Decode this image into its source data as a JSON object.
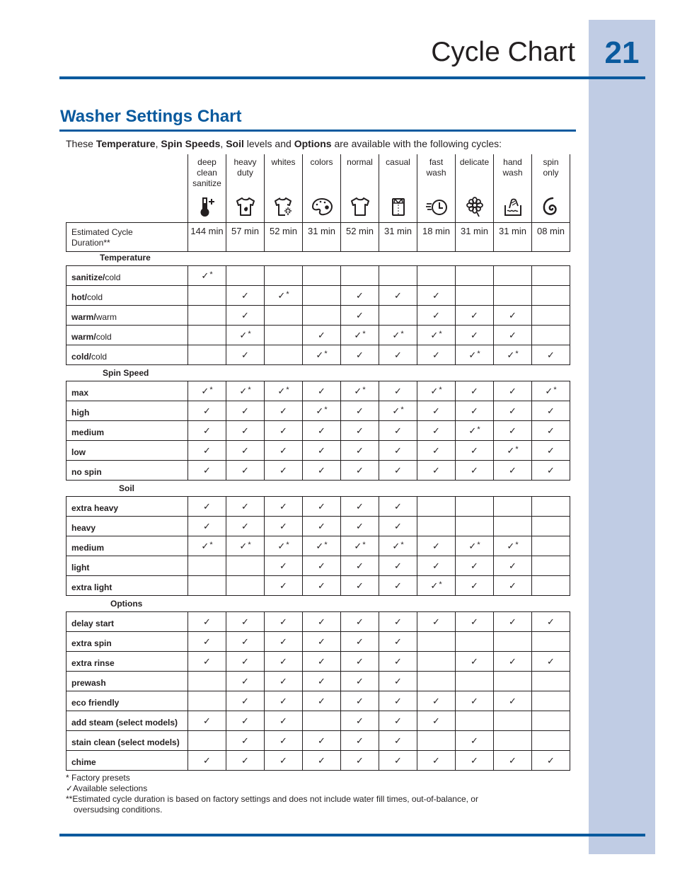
{
  "page": {
    "title": "Cycle Chart",
    "number": "21"
  },
  "section": {
    "title": "Washer Settings Chart",
    "intro": {
      "t1": "These ",
      "b1": "Temperature",
      "t2": ", ",
      "b2": "Spin Speeds",
      "t3": ", ",
      "b3": "Soil",
      "t4": " levels and ",
      "b4": "Options",
      "t5": " are available with the following cycles:"
    }
  },
  "colors": {
    "accent_blue": "#0a5a9e",
    "side_band": "#c0cce4",
    "text": "#231f20"
  },
  "cycles": [
    {
      "label": "deep clean sanitize",
      "lines": [
        "deep",
        "clean",
        "sanitize"
      ],
      "icon": "thermometer-plus-icon",
      "duration": "144 min"
    },
    {
      "label": "heavy duty",
      "lines": [
        "heavy",
        "duty"
      ],
      "icon": "shirt-stain-icon",
      "duration": "57 min"
    },
    {
      "label": "whites",
      "lines": [
        "whites"
      ],
      "icon": "shirt-sparkle-icon",
      "duration": "52 min"
    },
    {
      "label": "colors",
      "lines": [
        "colors"
      ],
      "icon": "palette-icon",
      "duration": "31 min"
    },
    {
      "label": "normal",
      "lines": [
        "normal"
      ],
      "icon": "shirt-icon",
      "duration": "52 min"
    },
    {
      "label": "casual",
      "lines": [
        "casual"
      ],
      "icon": "collared-shirt-icon",
      "duration": "31 min"
    },
    {
      "label": "fast wash",
      "lines": [
        "fast",
        "wash"
      ],
      "icon": "fast-clock-icon",
      "duration": "18 min"
    },
    {
      "label": "delicate",
      "lines": [
        "delicate"
      ],
      "icon": "flower-icon",
      "duration": "31 min"
    },
    {
      "label": "hand wash",
      "lines": [
        "hand",
        "wash"
      ],
      "icon": "hand-basin-icon",
      "duration": "31 min"
    },
    {
      "label": "spin only",
      "lines": [
        "spin",
        "only"
      ],
      "icon": "spiral-icon",
      "duration": "08 min"
    }
  ],
  "duration_label": {
    "line1": "Estimated Cycle",
    "line2": "Duration**"
  },
  "legend": {
    "check": "✓",
    "preset_mark": "*"
  },
  "groups": [
    {
      "title": "Temperature",
      "rows": [
        {
          "bold": "sanitize/",
          "normal": "cold",
          "cells": [
            "P",
            "",
            "",
            "",
            "",
            "",
            "",
            "",
            "",
            ""
          ]
        },
        {
          "bold": "hot/",
          "normal": "cold",
          "cells": [
            "",
            "A",
            "P",
            "",
            "A",
            "A",
            "A",
            "",
            "",
            ""
          ]
        },
        {
          "bold": "warm/",
          "normal": "warm",
          "cells": [
            "",
            "A",
            "",
            "",
            "A",
            "",
            "A",
            "A",
            "A",
            ""
          ]
        },
        {
          "bold": "warm/",
          "normal": "cold",
          "cells": [
            "",
            "P",
            "",
            "A",
            "P",
            "P",
            "P",
            "A",
            "A",
            ""
          ]
        },
        {
          "bold": "cold/",
          "normal": "cold",
          "cells": [
            "",
            "A",
            "",
            "P",
            "A",
            "A",
            "A",
            "P",
            "P",
            "A"
          ]
        }
      ]
    },
    {
      "title": "Spin Speed",
      "rows": [
        {
          "bold": "max",
          "normal": "",
          "cells": [
            "P",
            "P",
            "P",
            "A",
            "P",
            "A",
            "P",
            "A",
            "A",
            "P"
          ]
        },
        {
          "bold": "high",
          "normal": "",
          "cells": [
            "A",
            "A",
            "A",
            "P",
            "A",
            "P",
            "A",
            "A",
            "A",
            "A"
          ]
        },
        {
          "bold": "medium",
          "normal": "",
          "cells": [
            "A",
            "A",
            "A",
            "A",
            "A",
            "A",
            "A",
            "P",
            "A",
            "A"
          ]
        },
        {
          "bold": "low",
          "normal": "",
          "cells": [
            "A",
            "A",
            "A",
            "A",
            "A",
            "A",
            "A",
            "A",
            "P",
            "A"
          ]
        },
        {
          "bold": "no spin",
          "normal": "",
          "cells": [
            "A",
            "A",
            "A",
            "A",
            "A",
            "A",
            "A",
            "A",
            "A",
            "A"
          ]
        }
      ]
    },
    {
      "title": "Soil",
      "rows": [
        {
          "bold": "extra heavy",
          "normal": "",
          "cells": [
            "A",
            "A",
            "A",
            "A",
            "A",
            "A",
            "",
            "",
            "",
            ""
          ]
        },
        {
          "bold": "heavy",
          "normal": "",
          "cells": [
            "A",
            "A",
            "A",
            "A",
            "A",
            "A",
            "",
            "",
            "",
            ""
          ]
        },
        {
          "bold": "medium",
          "normal": "",
          "cells": [
            "P",
            "P",
            "P",
            "P",
            "P",
            "P",
            "A",
            "P",
            "P",
            ""
          ]
        },
        {
          "bold": "light",
          "normal": "",
          "cells": [
            "",
            "",
            "A",
            "A",
            "A",
            "A",
            "A",
            "A",
            "A",
            ""
          ]
        },
        {
          "bold": "extra light",
          "normal": "",
          "cells": [
            "",
            "",
            "A",
            "A",
            "A",
            "A",
            "P",
            "A",
            "A",
            ""
          ]
        }
      ]
    },
    {
      "title": "Options",
      "rows": [
        {
          "bold": "delay start",
          "normal": "",
          "cells": [
            "A",
            "A",
            "A",
            "A",
            "A",
            "A",
            "A",
            "A",
            "A",
            "A"
          ]
        },
        {
          "bold": "extra spin",
          "normal": "",
          "cells": [
            "A",
            "A",
            "A",
            "A",
            "A",
            "A",
            "",
            "",
            "",
            ""
          ]
        },
        {
          "bold": "extra rinse",
          "normal": "",
          "cells": [
            "A",
            "A",
            "A",
            "A",
            "A",
            "A",
            "",
            "A",
            "A",
            "A"
          ]
        },
        {
          "bold": "prewash",
          "normal": "",
          "cells": [
            "",
            "A",
            "A",
            "A",
            "A",
            "A",
            "",
            "",
            "",
            ""
          ]
        },
        {
          "bold": "eco friendly",
          "normal": "",
          "cells": [
            "",
            "A",
            "A",
            "A",
            "A",
            "A",
            "A",
            "A",
            "A",
            ""
          ]
        },
        {
          "bold": "add steam (select models)",
          "normal": "",
          "cells": [
            "A",
            "A",
            "A",
            "",
            "A",
            "A",
            "A",
            "",
            "",
            ""
          ]
        },
        {
          "bold": "stain clean (select models)",
          "normal": "",
          "cells": [
            "",
            "A",
            "A",
            "A",
            "A",
            "A",
            "",
            "A",
            "",
            ""
          ]
        },
        {
          "bold": "chime",
          "normal": "",
          "cells": [
            "A",
            "A",
            "A",
            "A",
            "A",
            "A",
            "A",
            "A",
            "A",
            "A"
          ]
        }
      ]
    }
  ],
  "notes": {
    "n1": "* Factory presets",
    "n2": "✓Available selections",
    "n3": "**Estimated cycle duration is based on factory settings and does not include water fill times, out-of-balance, or",
    "n3b": "oversudsing conditions."
  }
}
